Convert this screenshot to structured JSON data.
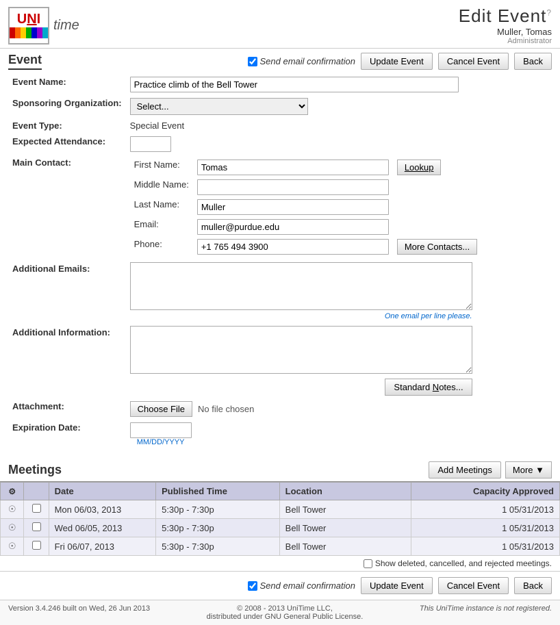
{
  "header": {
    "title": "Edit Event",
    "title_sup": "?",
    "user_name": "Muller, Tomas",
    "user_role": "Administrator"
  },
  "logo": {
    "uni": "UNI",
    "time": "time"
  },
  "event_section": {
    "title": "Event",
    "send_email_label": "Send email confirmation",
    "update_event_label": "Update Event",
    "cancel_event_label": "Cancel Event",
    "back_label": "Back"
  },
  "form": {
    "event_name_label": "Event Name:",
    "event_name_value": "Practice climb of the Bell Tower",
    "sponsoring_org_label": "Sponsoring Organization:",
    "sponsoring_org_placeholder": "Select...",
    "event_type_label": "Event Type:",
    "event_type_value": "Special Event",
    "expected_attendance_label": "Expected Attendance:",
    "expected_attendance_value": "",
    "main_contact_label": "Main Contact:",
    "first_name_label": "First Name:",
    "first_name_value": "Tomas",
    "lookup_label": "Lookup",
    "middle_name_label": "Middle Name:",
    "middle_name_value": "",
    "last_name_label": "Last Name:",
    "last_name_value": "Muller",
    "email_label": "Email:",
    "email_value": "muller@purdue.edu",
    "phone_label": "Phone:",
    "phone_value": "+1 765 494 3900",
    "more_contacts_label": "More Contacts...",
    "additional_emails_label": "Additional Emails:",
    "additional_emails_hint": "One email per line please.",
    "additional_info_label": "Additional Information:",
    "standard_notes_label": "Standard Notes...",
    "attachment_label": "Attachment:",
    "choose_file_label": "Choose File",
    "no_file_label": "No file chosen",
    "expiration_date_label": "Expiration Date:",
    "expiration_date_placeholder": "MM/DD/YYYY"
  },
  "meetings": {
    "title": "Meetings",
    "add_meetings_label": "Add Meetings",
    "more_label": "More ▼",
    "columns": {
      "date": "Date",
      "published_time": "Published Time",
      "location": "Location",
      "capacity_approved": "Capacity Approved"
    },
    "rows": [
      {
        "date": "Mon 06/03, 2013",
        "time": "5:30p - 7:30p",
        "location": "Bell Tower",
        "capacity": "1 05/31/2013"
      },
      {
        "date": "Wed 06/05, 2013",
        "time": "5:30p - 7:30p",
        "location": "Bell Tower",
        "capacity": "1 05/31/2013"
      },
      {
        "date": "Fri 06/07, 2013",
        "time": "5:30p - 7:30p",
        "location": "Bell Tower",
        "capacity": "1 05/31/2013"
      }
    ],
    "show_deleted_label": "Show deleted, cancelled, and rejected meetings."
  },
  "bottom": {
    "send_email_label": "Send email confirmation",
    "update_event_label": "Update Event",
    "cancel_event_label": "Cancel Event",
    "back_label": "Back"
  },
  "footer": {
    "left": "Version 3.4.246 built on Wed, 26 Jun 2013",
    "center_line1": "© 2008 - 2013 UniTime LLC,",
    "center_line2": "distributed under GNU General Public License.",
    "right": "This UniTime instance is not registered."
  }
}
